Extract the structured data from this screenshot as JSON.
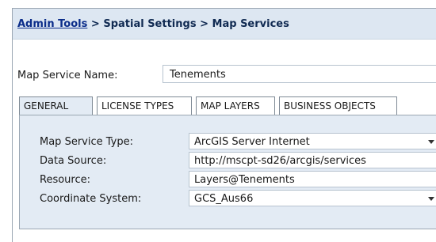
{
  "breadcrumb": {
    "link": "Admin Tools",
    "separator1": ">",
    "item2": "Spatial Settings",
    "separator2": ">",
    "item3": "Map Services"
  },
  "map_service_name": {
    "label": "Map Service Name:",
    "value": "Tenements"
  },
  "tabs": [
    {
      "label": "GENERAL",
      "active": true
    },
    {
      "label": "LICENSE TYPES",
      "active": false
    },
    {
      "label": "MAP LAYERS",
      "active": false
    },
    {
      "label": "BUSINESS OBJECTS",
      "active": false
    }
  ],
  "general": {
    "map_service_type": {
      "label": "Map Service Type:",
      "value": "ArcGIS Server Internet"
    },
    "data_source": {
      "label": "Data Source:",
      "value": "http://mscpt-sd26/arcgis/services"
    },
    "resource": {
      "label": "Resource:",
      "value": "Layers@Tenements"
    },
    "coordinate_system": {
      "label": "Coordinate System:",
      "value": "GCS_Aus66"
    }
  },
  "colors": {
    "header_bg": "#dde7f2",
    "panel_bg": "#e3ebf4",
    "link": "#0b2d8a"
  },
  "icons": [
    "chevron-down-icon"
  ]
}
